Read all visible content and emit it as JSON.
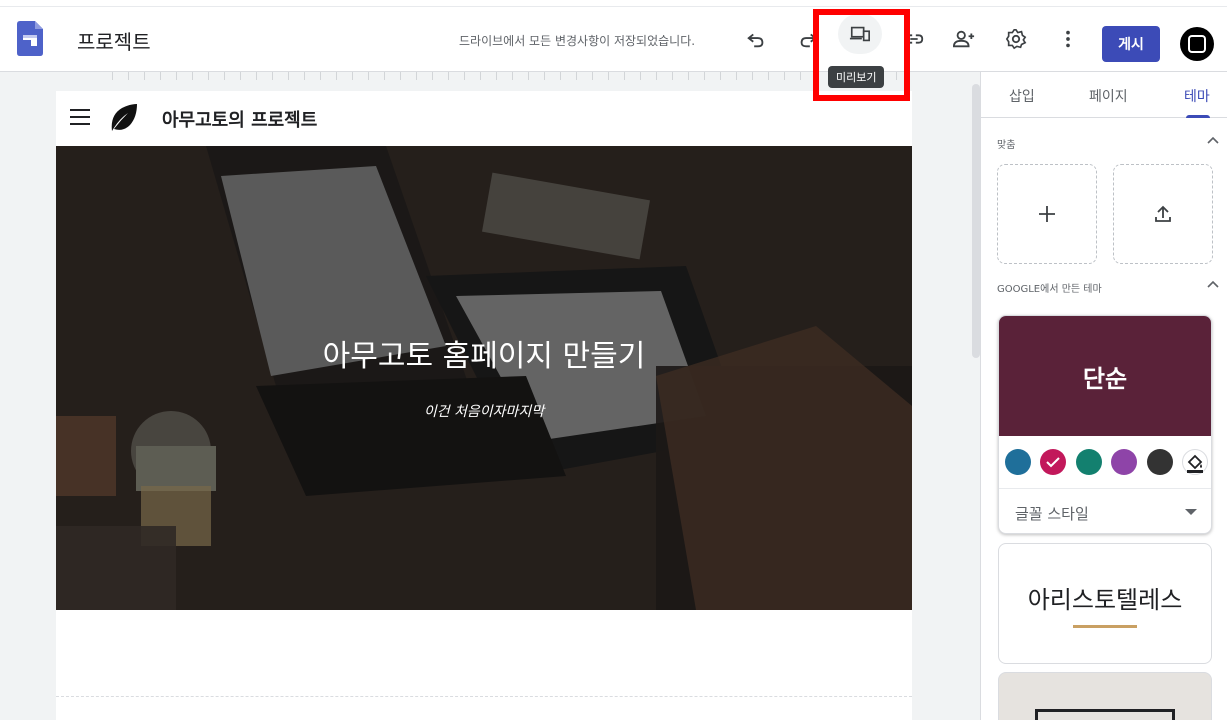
{
  "app": {
    "title": "프로젝트",
    "save_status": "드라이브에서 모든 변경사항이 저장되었습니다.",
    "publish_label": "게시",
    "tooltip": "미리보기"
  },
  "icons": {
    "logo": "google-sites-icon",
    "undo": "undo-icon",
    "redo": "redo-icon",
    "preview": "preview-devices-icon",
    "link": "link-icon",
    "share": "add-person-icon",
    "settings": "gear-icon",
    "more": "more-vert-icon"
  },
  "site": {
    "name": "아무고토의 프로젝트",
    "hero_title": "아무고토 홈페이지 만들기",
    "hero_subtitle": "이건 처음이자마지막"
  },
  "panel": {
    "tabs": [
      {
        "label": "삽입",
        "active": false
      },
      {
        "label": "페이지",
        "active": false
      },
      {
        "label": "테마",
        "active": true
      }
    ],
    "custom_label": "맞춤",
    "google_themes_label": "GOOGLE에서 만든 테마",
    "themes": [
      {
        "name": "단순",
        "color": "#5a2239"
      },
      {
        "name": "아리스토텔레스",
        "accent": "#c9a063"
      }
    ],
    "font_style_label": "글꼴 스타일",
    "swatch_colors": [
      "#1f6f9a",
      "#c2185b",
      "#13806f",
      "#8e44a8",
      "#333333"
    ]
  },
  "colors": {
    "accent": "#3c4bb7",
    "highlight": "#ff0000"
  }
}
